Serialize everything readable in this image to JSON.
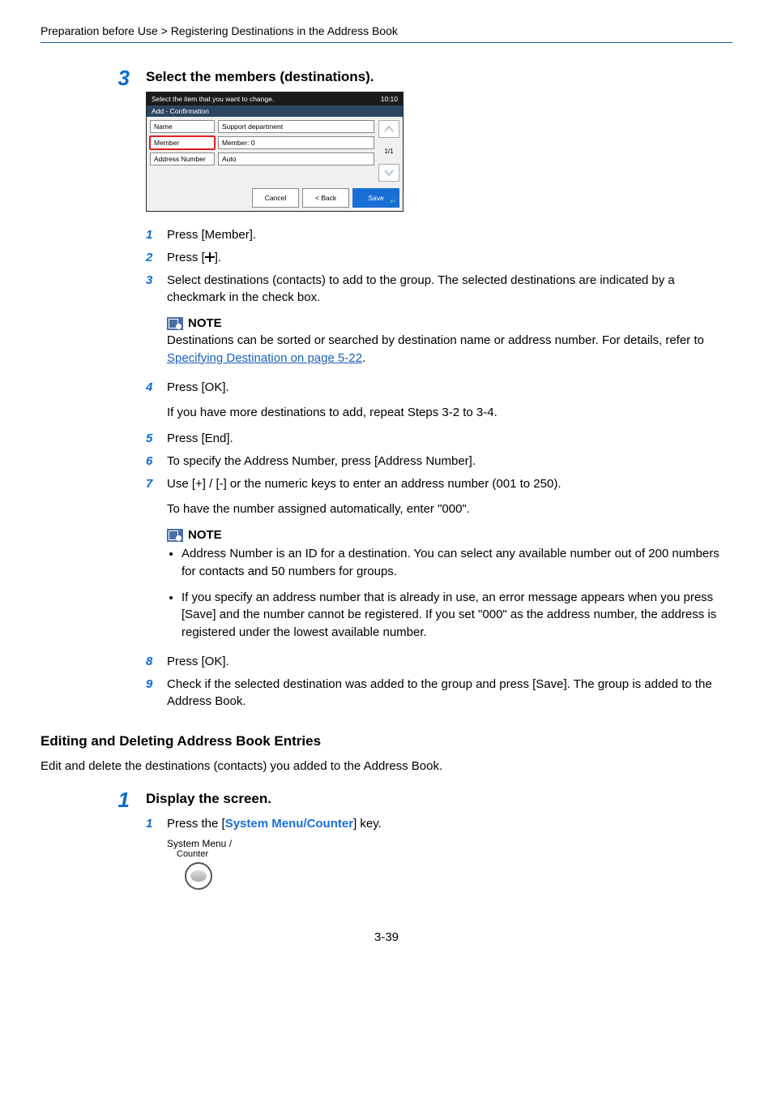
{
  "breadcrumb": "Preparation before Use > Registering Destinations in the Address Book",
  "major3": {
    "num": "3",
    "title": "Select the members (destinations).",
    "device": {
      "top_msg": "Select the item that you want to change.",
      "time": "10:10",
      "subtitle": "Add - Confirmation",
      "row1_label": "Name",
      "row1_value": "Support department",
      "row2_label": "Member",
      "row2_value": "Member: 0",
      "row3_label": "Address Number",
      "row3_value": "Auto",
      "side_page": "1/1",
      "btn_cancel": "Cancel",
      "btn_back": "< Back",
      "btn_save": "Save"
    },
    "steps": {
      "s1": "Press [Member].",
      "s2_a": "Press [",
      "s2_b": "].",
      "s3": "Select destinations (contacts) to add to the group. The selected destinations are indicated by a checkmark in the check box.",
      "note1_title": "NOTE",
      "note1_text_a": "Destinations can be sorted or searched by destination name or address number. For details, refer to ",
      "note1_link": "Specifying Destination on page 5-22",
      "note1_text_b": ".",
      "s4": "Press [OK].",
      "s4_extra": "If you have more destinations to add, repeat Steps 3-2 to 3-4.",
      "s5": "Press [End].",
      "s6": "To specify the Address Number, press [Address Number].",
      "s7": "Use [+] / [-] or the numeric keys to enter an address number (001 to 250).",
      "s7_extra": "To have the number assigned automatically, enter \"000\".",
      "note2_title": "NOTE",
      "note2_li1": "Address Number is an ID for a destination. You can select any available number out of 200 numbers for contacts and 50 numbers for groups.",
      "note2_li2": "If you specify an address number that is already in use, an error message appears when you press [Save] and the number cannot be registered. If you set \"000\" as the address number, the address is registered under the lowest available number.",
      "s8": "Press [OK].",
      "s9": "Check if the selected destination was added to the group and press [Save]. The group is added to the Address Book."
    }
  },
  "section2": {
    "heading": "Editing and Deleting Address Book Entries",
    "intro": "Edit and delete the destinations (contacts) you added to the Address Book."
  },
  "major1": {
    "num": "1",
    "title": "Display the screen.",
    "s1_a": "Press the [",
    "s1_key": "System Menu/Counter",
    "s1_b": "] key.",
    "hw_label1": "System Menu /",
    "hw_label2": "Counter"
  },
  "page_number": "3-39"
}
